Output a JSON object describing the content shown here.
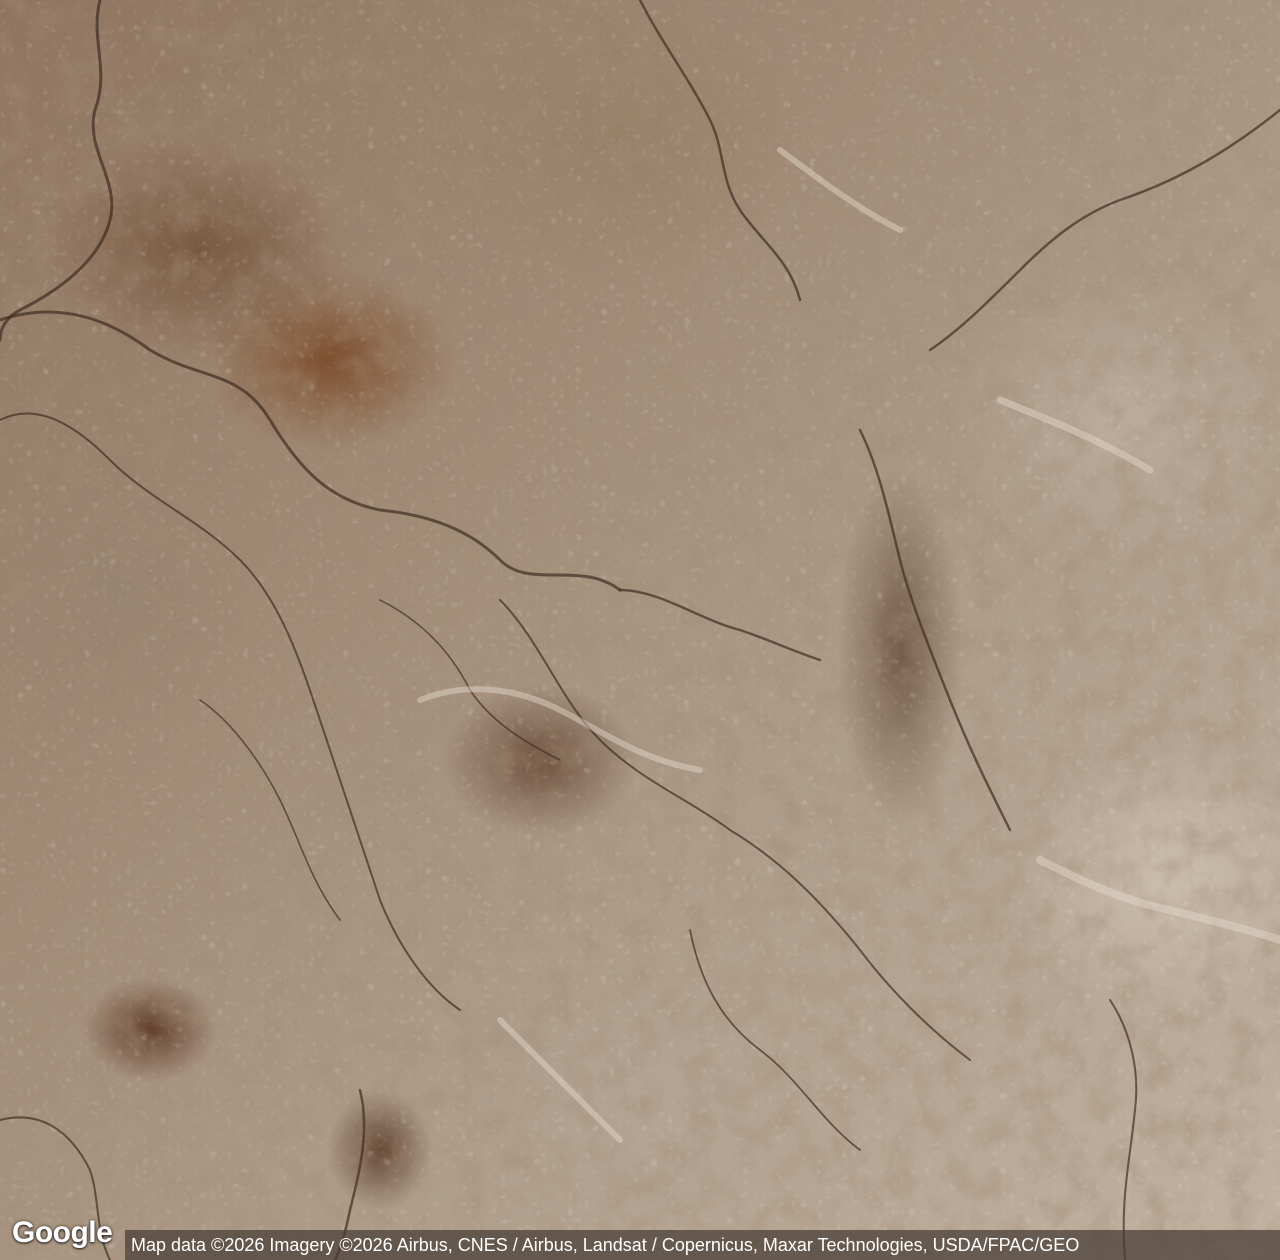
{
  "map": {
    "type": "satellite",
    "logo_text": "Google",
    "attribution": "Map data ©2026 Imagery ©2026 Airbus, CNES / Airbus, Landsat / Copernicus, Maxar Technologies, USDA/FPAC/GEO"
  }
}
